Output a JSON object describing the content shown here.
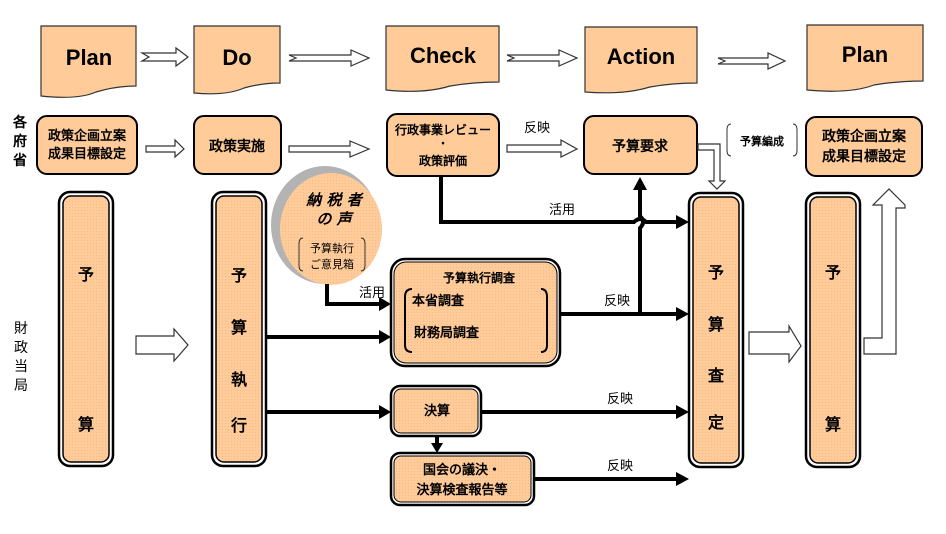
{
  "colors": {
    "box_fill": "#ffcc99",
    "stroke": "#000000",
    "background": "#ffffff"
  },
  "phases": [
    {
      "label": "Plan"
    },
    {
      "label": "Do"
    },
    {
      "label": "Check"
    },
    {
      "label": "Action"
    },
    {
      "label": "Plan"
    }
  ],
  "row_labels": {
    "ministries": [
      "各",
      "府",
      "省"
    ],
    "finance": [
      "財",
      "政",
      "当",
      "局"
    ]
  },
  "ministry_boxes": {
    "plan1": [
      "政策企画立案",
      "成果目標設定"
    ],
    "do": [
      "政策実施"
    ],
    "check": [
      "行政事業レビュー",
      "・",
      "政策評価"
    ],
    "action": [
      "予算要求"
    ],
    "plan2": [
      "政策企画立案",
      "成果目標設定"
    ]
  },
  "bars": {
    "budget1": [
      "予",
      "算"
    ],
    "execution": [
      "予",
      "算",
      "執",
      "行"
    ],
    "assessment": [
      "予",
      "算",
      "査",
      "定"
    ],
    "budget2": [
      "予",
      "算"
    ]
  },
  "taxpayer": {
    "title_lines": [
      "納 税 者",
      "の 声"
    ],
    "sub_lines": [
      "予算執行",
      "ご意見箱"
    ]
  },
  "survey_box": {
    "title": "予算執行調査",
    "items": [
      "本省調査",
      "財務局調査"
    ]
  },
  "settlement_box": {
    "label": "決算"
  },
  "diet_box": {
    "lines": [
      "国会の議決・",
      "決算検査報告等"
    ]
  },
  "edge_labels": {
    "reflect_check_action": "反映",
    "use_review": "活用",
    "use_taxpayer": "活用",
    "reflect_survey": "反映",
    "reflect_settlement": "反映",
    "reflect_diet": "反映",
    "budget_compilation": "予算編成"
  }
}
